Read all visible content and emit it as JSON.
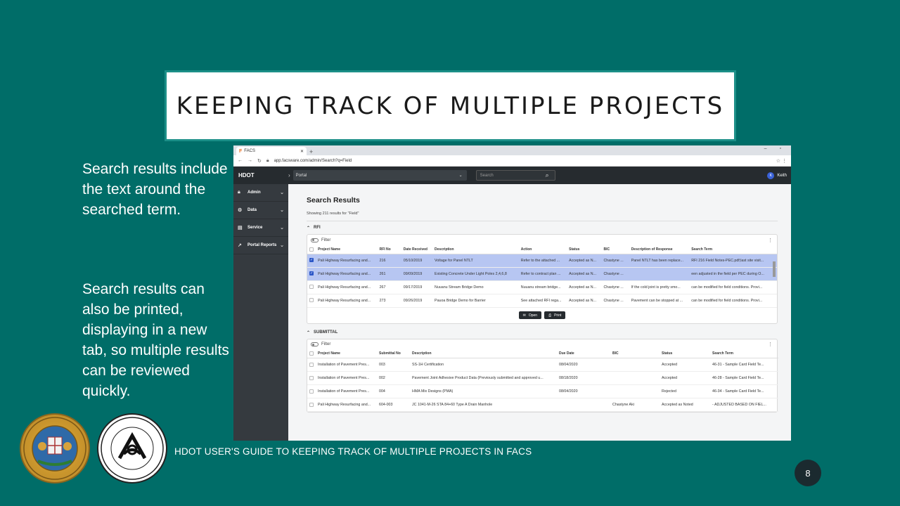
{
  "slide": {
    "title": "KEEPING TRACK OF MULTIPLE PROJECTS",
    "bullet1": "Search results include the text around the searched term.",
    "bullet2": "Search results can also be printed, displaying in a new tab, so multiple results can be reviewed quickly.",
    "footer": "HDOT USER'S GUIDE TO KEEPING TRACK OF MULTIPLE PROJECTS IN FACS",
    "page_number": "8"
  },
  "browser": {
    "tab_title": "FACS",
    "url": "app.facsware.com/admin/Search?q=Field"
  },
  "app": {
    "brand": "HDOT",
    "portal_label": "Portal",
    "search_placeholder": "Search",
    "user_initial": "K",
    "user_name": "Keith",
    "sidebar": [
      {
        "label": "Admin",
        "icon": "lock-icon"
      },
      {
        "label": "Data",
        "icon": "gears-icon"
      },
      {
        "label": "Service",
        "icon": "document-icon"
      },
      {
        "label": "Portal Reports",
        "icon": "chart-icon"
      }
    ],
    "page_title": "Search Results",
    "result_count": "Showing 211 results for \"Field\"",
    "rfi": {
      "section_label": "RFI",
      "filter_label": "Filter",
      "columns": [
        "Project Name",
        "RFI No",
        "Date Received",
        "Description",
        "Action",
        "Status",
        "BIC",
        "Description of Response",
        "Search Term"
      ],
      "rows": [
        {
          "selected": true,
          "cells": [
            "Pali Highway Resurfacing and...",
            "216",
            "05/10/2019",
            "Voltage for Panel NTLT",
            "Refer to the attached ...",
            "Accepted as N...",
            "Chastyne ...",
            "Panel NTLT has been replace...",
            "RFI 216 Field Notes-PEC.pdf;last site visit..."
          ]
        },
        {
          "selected": true,
          "cells": [
            "Pali Highway Resurfacing and...",
            "261",
            "09/09/2019",
            "Existing Concrete Under Light Poles 2,4,6,8",
            "Refer to contract plan ...",
            "Accepted as N...",
            "Chastyne ...",
            "",
            "een adjusted in the field per PEC during O..."
          ]
        },
        {
          "selected": false,
          "cells": [
            "Pali Highway Resurfacing and...",
            "267",
            "09/17/2019",
            "Nuuanu Stream Bridge Demo",
            "Nuuanu stream bridge...",
            "Accepted as N...",
            "Chastyne ...",
            "If the cold joint is pretty smo...",
            "can be modified for field conditions. Provi..."
          ]
        },
        {
          "selected": false,
          "cells": [
            "Pali Highway Resurfacing and...",
            "273",
            "09/26/2019",
            "Pauoa Bridge Demo for Barrier",
            "See attached RFI rega...",
            "Accepted as N...",
            "Chastyne ...",
            "Pavement can be stopped at ...",
            "can be modified for field conditions. Provi..."
          ]
        }
      ],
      "open_label": "Open",
      "print_label": "Print"
    },
    "submittal": {
      "section_label": "SUBMITTAL",
      "filter_label": "Filter",
      "columns": [
        "Project Name",
        "Submittal No",
        "Description",
        "Due Date",
        "BIC",
        "Status",
        "Search Term"
      ],
      "rows": [
        {
          "cells": [
            "Installation of Pavement Pres...",
            "003",
            "SS-1H Certification",
            "08/04/2020",
            "",
            "Accepted",
            "46-31 - Sample Card Field Te..."
          ]
        },
        {
          "cells": [
            "Installation of Pavement Pres...",
            "002",
            "Pavement Joint Adhesive Product Data (Previously submitted and approved u...",
            "08/18/2020",
            "",
            "Accepted",
            "46-28 - Sample Card Field Te..."
          ]
        },
        {
          "cells": [
            "Installation of Pavement Pres...",
            "004",
            "HMA Mix Designs (PMA)",
            "08/04/2020",
            "",
            "Rejected",
            "46-34 - Sample Card Field Te..."
          ]
        },
        {
          "cells": [
            "Pali Highway Resurfacing and...",
            "604-003",
            "JC 1041-M-26 STA 84+60 Type A Drain Manhole",
            "",
            "Chastyne Aki",
            "Accepted as Noted",
            "- ADJUSTED BASED ON FIEL..."
          ]
        }
      ]
    }
  }
}
